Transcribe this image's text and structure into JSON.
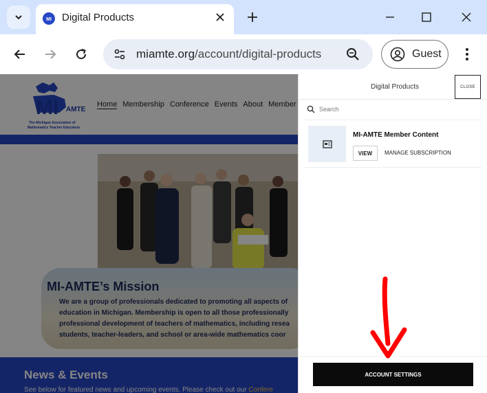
{
  "browser": {
    "tab_title": "Digital Products",
    "url_domain": "miamte.org",
    "url_path": "/account/digital-products",
    "profile_label": "Guest"
  },
  "site": {
    "logo_letters": "MI",
    "logo_sub": "AMTE",
    "logo_caption": "The Michigan Association of Mathematics Teacher Educators",
    "nav": [
      "Home",
      "Membership",
      "Conference",
      "Events",
      "About",
      "Member A"
    ],
    "mission_title": "MI-AMTE’s Mission",
    "mission_lines": [
      "We are a group of professionals dedicated to promoting all aspects of",
      "education in Michigan. Membership is open to all those professionally",
      "professional development of teachers of mathematics, including resea",
      "students, teacher-leaders, and school or area-wide mathematics coor"
    ],
    "news_title": "News & Events",
    "news_text": "See below for featured news and upcoming events. Please check out our",
    "news_link": "Confere"
  },
  "panel": {
    "title": "Digital Products",
    "close_label": "CLOSE",
    "search_placeholder": "Search",
    "product_name": "MI-AMTE Member Content",
    "view_label": "VIEW",
    "manage_label": "MANAGE SUBSCRIPTION",
    "account_settings_label": "ACCOUNT SETTINGS"
  },
  "colors": {
    "site_blue": "#2747c6",
    "annotation_arrow": "#ff0000"
  }
}
